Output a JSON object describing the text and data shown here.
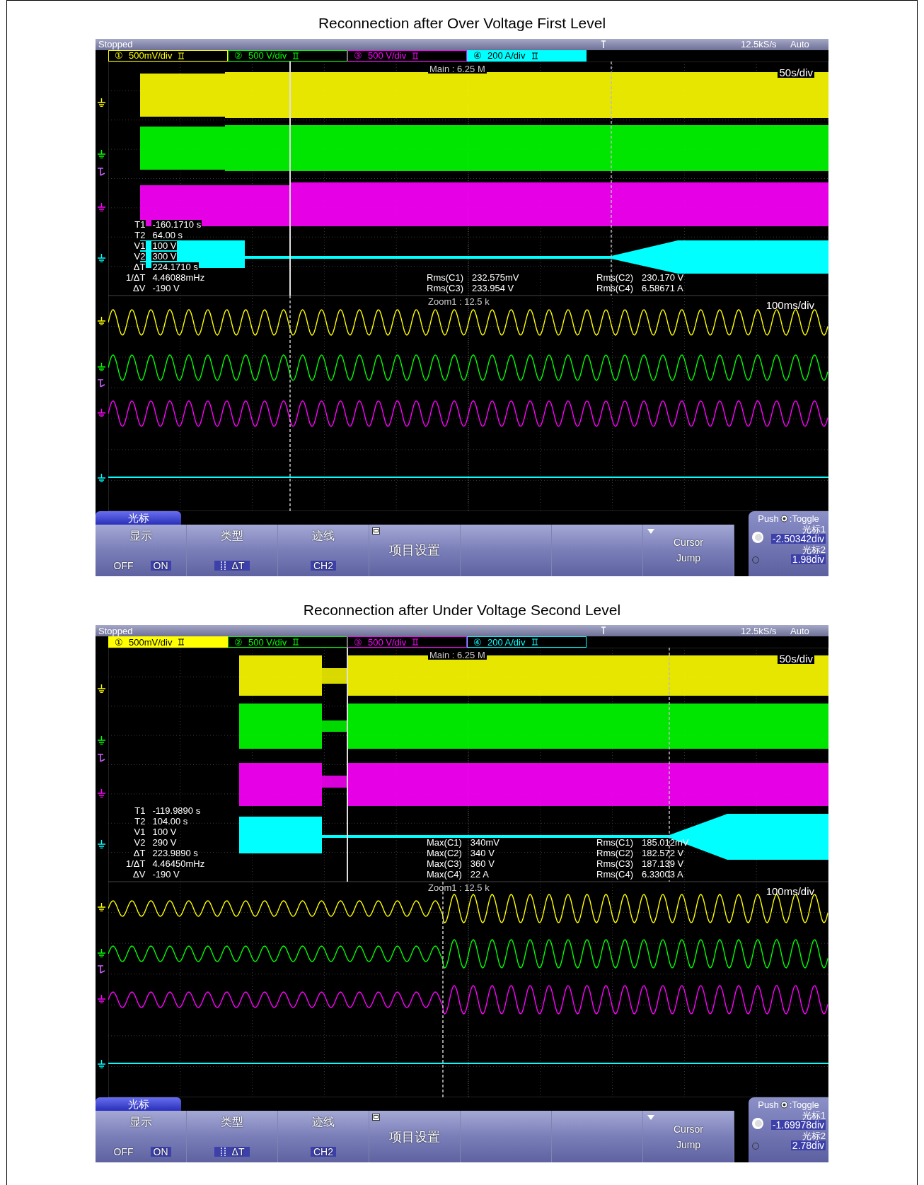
{
  "scopes": [
    {
      "title": "Reconnection after Over Voltage First Level",
      "status": {
        "state": "Stopped",
        "rate": "12.5kS/s",
        "mode": "Auto"
      },
      "channels": [
        {
          "number": "①",
          "scale": "500mV/div",
          "color": "#ffff00",
          "selected": false
        },
        {
          "number": "②",
          "scale": "500 V/div",
          "color": "#00ff00",
          "selected": false
        },
        {
          "number": "③",
          "scale": "500 V/div",
          "color": "#ff00ff",
          "selected": false
        },
        {
          "number": "④",
          "scale": "200 A/div",
          "color": "#00ffff",
          "selected": true
        }
      ],
      "main": {
        "label": "Main : 6.25 M",
        "timebase": "50s/div"
      },
      "cursor_readout": [
        {
          "label": "T1",
          "value": "-160.1710 s"
        },
        {
          "label": "T2",
          "value": "64.00 s"
        },
        {
          "label": "V1",
          "value": "100 V"
        },
        {
          "label": "V2",
          "value": "300 V"
        },
        {
          "label": "ΔT",
          "value": "224.1710 s"
        },
        {
          "label": "1/ΔT",
          "value": "4.46088mHz"
        },
        {
          "label": "ΔV",
          "value": "-190 V"
        }
      ],
      "measurements": [
        [
          {
            "label": "Rms(C1)",
            "value": "232.575mV"
          },
          {
            "label": "Rms(C3)",
            "value": "233.954 V"
          }
        ],
        [
          {
            "label": "Rms(C2)",
            "value": "230.170 V"
          },
          {
            "label": "Rms(C4)",
            "value": "6.58671 A"
          }
        ]
      ],
      "zoom": {
        "label": "Zoom1 : 12.5 k",
        "timebase": "100ms/div"
      },
      "menu": {
        "tab": "光标",
        "keys": [
          {
            "kind": "toggle",
            "label": "显示",
            "options": [
              {
                "text": "OFF",
                "selected": false
              },
              {
                "text": "ON",
                "selected": true
              }
            ]
          },
          {
            "kind": "type",
            "label": "类型",
            "value": "ΔT"
          },
          {
            "kind": "value",
            "label": "迹线",
            "value": "CH2"
          },
          {
            "kind": "menu",
            "label": "项目设置"
          },
          {
            "kind": "blank"
          },
          {
            "kind": "blank"
          },
          {
            "kind": "dropdown",
            "lines": [
              "Cursor",
              "Jump"
            ]
          }
        ]
      },
      "cursor_panel": {
        "push": "Push",
        "toggle": ":Toggle",
        "cursors": [
          {
            "label": "光标1",
            "value": "-2.50342div",
            "selected": true
          },
          {
            "label": "光标2",
            "value": "1.98div",
            "selected": false
          }
        ]
      }
    },
    {
      "title": "Reconnection after Under Voltage Second Level",
      "status": {
        "state": "Stopped",
        "rate": "12.5kS/s",
        "mode": "Auto"
      },
      "channels": [
        {
          "number": "①",
          "scale": "500mV/div",
          "color": "#ffff00",
          "selected": true
        },
        {
          "number": "②",
          "scale": "500 V/div",
          "color": "#00ff00",
          "selected": false
        },
        {
          "number": "③",
          "scale": "500 V/div",
          "color": "#ff00ff",
          "selected": false
        },
        {
          "number": "④",
          "scale": "200 A/div",
          "color": "#00ffff",
          "selected": false
        }
      ],
      "main": {
        "label": "Main : 6.25 M",
        "timebase": "50s/div"
      },
      "cursor_readout": [
        {
          "label": "T1",
          "value": "-119.9890 s"
        },
        {
          "label": "T2",
          "value": "104.00 s"
        },
        {
          "label": "V1",
          "value": "100 V"
        },
        {
          "label": "V2",
          "value": "290 V"
        },
        {
          "label": "ΔT",
          "value": "223.9890 s"
        },
        {
          "label": "1/ΔT",
          "value": "4.46450mHz"
        },
        {
          "label": "ΔV",
          "value": "-190 V"
        }
      ],
      "measurements": [
        [
          {
            "label": "Max(C1)",
            "value": "340mV"
          },
          {
            "label": "Max(C2)",
            "value": "340 V"
          },
          {
            "label": "Max(C3)",
            "value": "360 V"
          },
          {
            "label": "Max(C4)",
            "value": "22 A"
          }
        ],
        [
          {
            "label": "Rms(C1)",
            "value": "185.012mV"
          },
          {
            "label": "Rms(C2)",
            "value": "182.572 V"
          },
          {
            "label": "Rms(C3)",
            "value": "187.139 V"
          },
          {
            "label": "Rms(C4)",
            "value": "6.33003 A"
          }
        ]
      ],
      "zoom": {
        "label": "Zoom1 : 12.5 k",
        "timebase": "100ms/div"
      },
      "menu": {
        "tab": "光标",
        "keys": [
          {
            "kind": "toggle",
            "label": "显示",
            "options": [
              {
                "text": "OFF",
                "selected": false
              },
              {
                "text": "ON",
                "selected": true
              }
            ]
          },
          {
            "kind": "type",
            "label": "类型",
            "value": "ΔT"
          },
          {
            "kind": "value",
            "label": "迹线",
            "value": "CH2"
          },
          {
            "kind": "menu",
            "label": "项目设置"
          },
          {
            "kind": "blank"
          },
          {
            "kind": "blank"
          },
          {
            "kind": "dropdown",
            "lines": [
              "Cursor",
              "Jump"
            ]
          }
        ]
      },
      "cursor_panel": {
        "push": "Push",
        "toggle": ":Toggle",
        "cursors": [
          {
            "label": "光标1",
            "value": "-1.69978div",
            "selected": true
          },
          {
            "label": "光标2",
            "value": "2.78div",
            "selected": false
          }
        ]
      }
    }
  ]
}
